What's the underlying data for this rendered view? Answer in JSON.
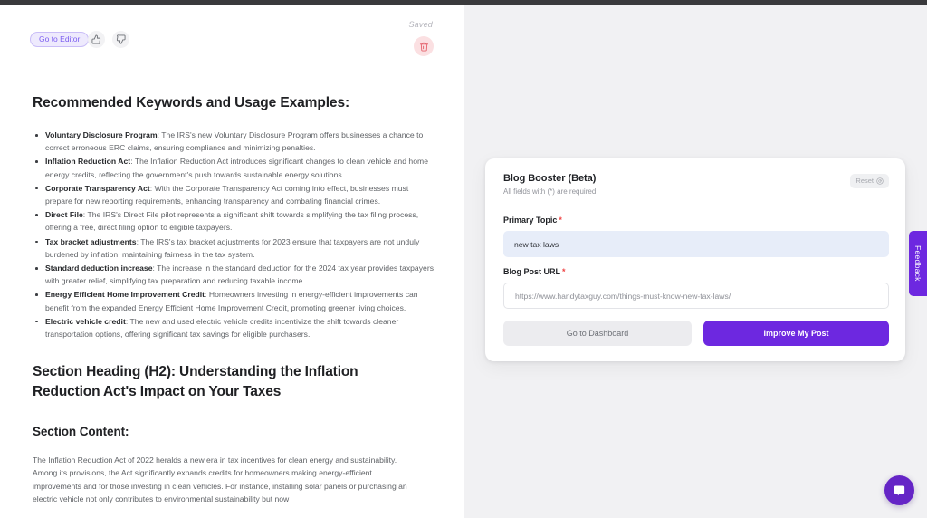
{
  "toolbar": {
    "editor_button": "Go to Editor",
    "thumb_up_icon": "thumbs-up-icon",
    "thumb_down_icon": "thumbs-down-icon",
    "saved_label": "Saved",
    "delete_icon": "trash-icon"
  },
  "document": {
    "heading": "Recommended Keywords and Usage Examples:",
    "keywords": [
      {
        "term": "Voluntary Disclosure Program",
        "description": ": The IRS's new Voluntary Disclosure Program offers businesses a chance to correct erroneous ERC claims, ensuring compliance and minimizing penalties."
      },
      {
        "term": "Inflation Reduction Act",
        "description": ": The Inflation Reduction Act introduces significant changes to clean vehicle and home energy credits, reflecting the government's push towards sustainable energy solutions."
      },
      {
        "term": "Corporate Transparency Act",
        "description": ": With the Corporate Transparency Act coming into effect, businesses must prepare for new reporting requirements, enhancing transparency and combating financial crimes."
      },
      {
        "term": "Direct File",
        "description": ": The IRS's Direct File pilot represents a significant shift towards simplifying the tax filing process, offering a free, direct filing option to eligible taxpayers."
      },
      {
        "term": "Tax bracket adjustments",
        "description": ": The IRS's tax bracket adjustments for 2023 ensure that taxpayers are not unduly burdened by inflation, maintaining fairness in the tax system."
      },
      {
        "term": "Standard deduction increase",
        "description": ": The increase in the standard deduction for the 2024 tax year provides taxpayers with greater relief, simplifying tax preparation and reducing taxable income."
      },
      {
        "term": "Energy Efficient Home Improvement Credit",
        "description": ": Homeowners investing in energy-efficient improvements can benefit from the expanded Energy Efficient Home Improvement Credit, promoting greener living choices."
      },
      {
        "term": "Electric vehicle credit",
        "description": ": The new and used electric vehicle credits incentivize the shift towards cleaner transportation options, offering significant tax savings for eligible purchasers."
      }
    ],
    "section_heading": "Section Heading (H2): Understanding the Inflation Reduction Act's Impact on Your Taxes",
    "section_content_label": "Section Content:",
    "body_paragraph": "The Inflation Reduction Act of 2022 heralds a new era in tax incentives for clean energy and sustainability. Among its provisions, the Act significantly expands credits for homeowners making energy-efficient improvements and for those investing in clean vehicles. For instance, installing solar panels or purchasing an electric vehicle not only contributes to environmental sustainability but now"
  },
  "card": {
    "title": "Blog Booster (Beta)",
    "subtitle": "All fields with (*) are required",
    "reset_label": "Reset",
    "reset_icon": "refresh-circle-icon",
    "fields": {
      "topic": {
        "label": "Primary Topic",
        "required_marker": "*",
        "value": "new tax laws"
      },
      "url": {
        "label": "Blog Post URL",
        "required_marker": "*",
        "placeholder": "https://www.handytaxguy.com/things-must-know-new-tax-laws/",
        "value": "https://www.handytaxguy.com/things-must-know-new-tax-laws/"
      }
    },
    "buttons": {
      "dashboard": "Go to Dashboard",
      "improve": "Improve My Post"
    }
  },
  "feedback_tab": {
    "label": "Feedback"
  },
  "chat": {
    "icon": "chat-bubble-icon"
  },
  "colors": {
    "accent_purple": "#6d28e0",
    "editor_purple": "#7b5cf0",
    "required_red": "#ef4444",
    "topic_field_bg": "#e7edf9",
    "right_pane_bg": "#f1f1f3",
    "chat_purple": "#6525c6"
  }
}
